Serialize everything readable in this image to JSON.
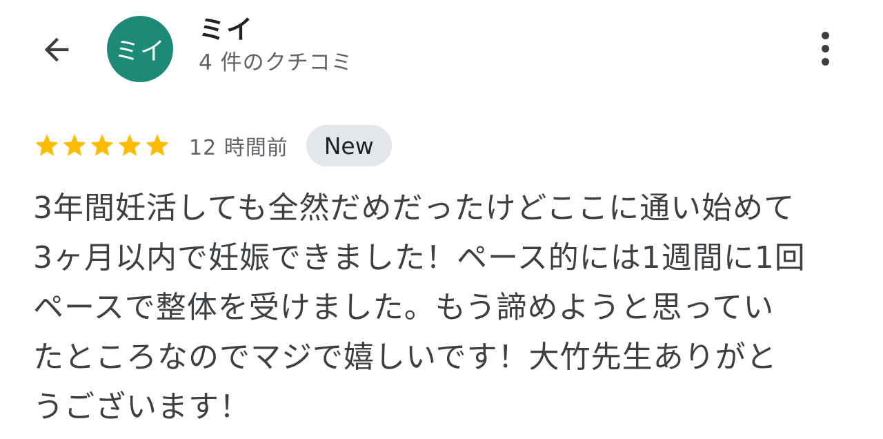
{
  "header": {
    "back_icon": "arrow-left-icon",
    "avatar_text": "ミイ",
    "avatar_color": "#1d8a78",
    "author_name": "ミイ",
    "review_count": "4 件のクチコミ",
    "more_icon": "more-vertical-icon"
  },
  "review": {
    "rating": 5,
    "rating_max": 5,
    "star_color": "#fbbc04",
    "time_ago": "12 時間前",
    "badge": "New",
    "text": "3年間妊活しても全然だめだったけどここに通い始めて\n3ヶ月以内で妊娠できました！ペース的には1週間に1回\nペースで整体を受けました。もう諦めようと思ってい\nたところなのでマジで嬉しいです！大竹先生ありがと\nうございます！"
  }
}
